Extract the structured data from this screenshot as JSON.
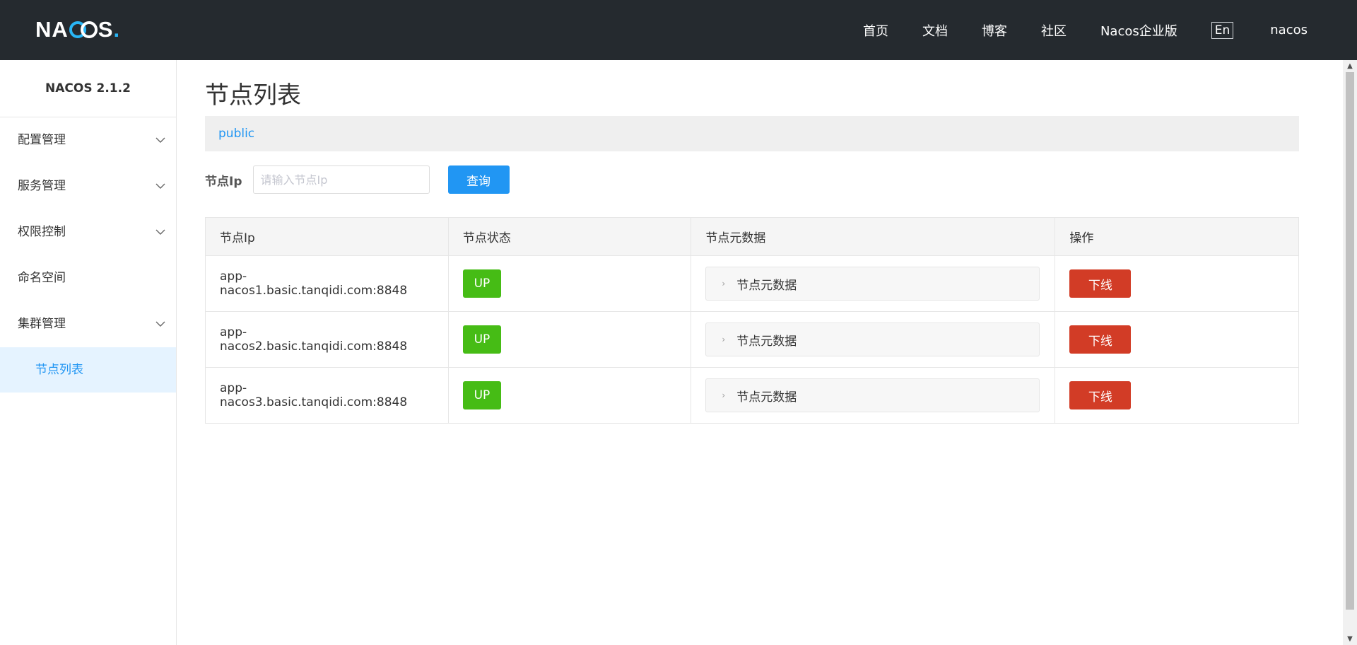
{
  "header": {
    "logo_prefix": "NA",
    "logo_suffix": "S",
    "logo_dot": ".",
    "nav": [
      "首页",
      "文档",
      "博客",
      "社区",
      "Nacos企业版"
    ],
    "lang": "En",
    "user": "nacos"
  },
  "sidebar": {
    "version": "NACOS 2.1.2",
    "items": [
      {
        "label": "配置管理"
      },
      {
        "label": "服务管理"
      },
      {
        "label": "权限控制"
      },
      {
        "label": "命名空间"
      },
      {
        "label": "集群管理"
      }
    ],
    "sub_active": "节点列表"
  },
  "main": {
    "title": "节点列表",
    "namespace": "public",
    "search": {
      "label": "节点Ip",
      "placeholder": "请输入节点Ip",
      "value": "",
      "button": "查询"
    },
    "table": {
      "headers": [
        "节点Ip",
        "节点状态",
        "节点元数据",
        "操作"
      ],
      "rows": [
        {
          "ip": "app-nacos1.basic.tanqidi.com:8848",
          "status": "UP",
          "meta": "节点元数据",
          "action": "下线"
        },
        {
          "ip": "app-nacos2.basic.tanqidi.com:8848",
          "status": "UP",
          "meta": "节点元数据",
          "action": "下线"
        },
        {
          "ip": "app-nacos3.basic.tanqidi.com:8848",
          "status": "UP",
          "meta": "节点元数据",
          "action": "下线"
        }
      ]
    }
  },
  "colors": {
    "header_bg": "#252a2f",
    "primary": "#2196f3",
    "success": "#46bc15",
    "danger": "#d23c26"
  }
}
